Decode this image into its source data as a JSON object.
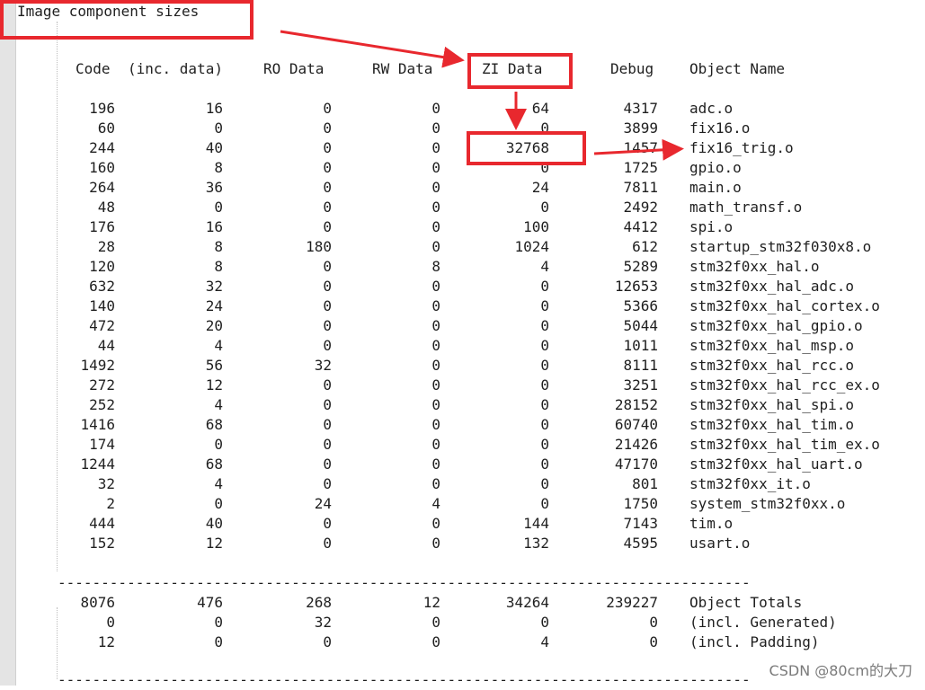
{
  "title": "Image component sizes",
  "headers": {
    "code": "Code",
    "inc": "(inc. data)",
    "ro": "RO Data",
    "rw": "RW Data",
    "zi": "ZI Data",
    "debug": "Debug",
    "name": "Object Name"
  },
  "rows": [
    [
      "196",
      "16",
      "0",
      "0",
      "64",
      "4317",
      "adc.o"
    ],
    [
      "60",
      "0",
      "0",
      "0",
      "0",
      "3899",
      "fix16.o"
    ],
    [
      "244",
      "40",
      "0",
      "0",
      "32768",
      "1457",
      "fix16_trig.o"
    ],
    [
      "160",
      "8",
      "0",
      "0",
      "0",
      "1725",
      "gpio.o"
    ],
    [
      "264",
      "36",
      "0",
      "0",
      "24",
      "7811",
      "main.o"
    ],
    [
      "48",
      "0",
      "0",
      "0",
      "0",
      "2492",
      "math_transf.o"
    ],
    [
      "176",
      "16",
      "0",
      "0",
      "100",
      "4412",
      "spi.o"
    ],
    [
      "28",
      "8",
      "180",
      "0",
      "1024",
      "612",
      "startup_stm32f030x8.o"
    ],
    [
      "120",
      "8",
      "0",
      "8",
      "4",
      "5289",
      "stm32f0xx_hal.o"
    ],
    [
      "632",
      "32",
      "0",
      "0",
      "0",
      "12653",
      "stm32f0xx_hal_adc.o"
    ],
    [
      "140",
      "24",
      "0",
      "0",
      "0",
      "5366",
      "stm32f0xx_hal_cortex.o"
    ],
    [
      "472",
      "20",
      "0",
      "0",
      "0",
      "5044",
      "stm32f0xx_hal_gpio.o"
    ],
    [
      "44",
      "4",
      "0",
      "0",
      "0",
      "1011",
      "stm32f0xx_hal_msp.o"
    ],
    [
      "1492",
      "56",
      "32",
      "0",
      "0",
      "8111",
      "stm32f0xx_hal_rcc.o"
    ],
    [
      "272",
      "12",
      "0",
      "0",
      "0",
      "3251",
      "stm32f0xx_hal_rcc_ex.o"
    ],
    [
      "252",
      "4",
      "0",
      "0",
      "0",
      "28152",
      "stm32f0xx_hal_spi.o"
    ],
    [
      "1416",
      "68",
      "0",
      "0",
      "0",
      "60740",
      "stm32f0xx_hal_tim.o"
    ],
    [
      "174",
      "0",
      "0",
      "0",
      "0",
      "21426",
      "stm32f0xx_hal_tim_ex.o"
    ],
    [
      "1244",
      "68",
      "0",
      "0",
      "0",
      "47170",
      "stm32f0xx_hal_uart.o"
    ],
    [
      "32",
      "4",
      "0",
      "0",
      "0",
      "801",
      "stm32f0xx_it.o"
    ],
    [
      "2",
      "0",
      "24",
      "4",
      "0",
      "1750",
      "system_stm32f0xx.o"
    ],
    [
      "444",
      "40",
      "0",
      "0",
      "144",
      "7143",
      "tim.o"
    ],
    [
      "152",
      "12",
      "0",
      "0",
      "132",
      "4595",
      "usart.o"
    ]
  ],
  "separator": "----------------------------------------------------------------------------------------------------------------",
  "totals": [
    [
      "8076",
      "476",
      "268",
      "12",
      "34264",
      "239227",
      "Object Totals"
    ],
    [
      "0",
      "0",
      "32",
      "0",
      "0",
      "0",
      "(incl. Generated)"
    ],
    [
      "12",
      "0",
      "0",
      "0",
      "4",
      "0",
      "(incl. Padding)"
    ]
  ],
  "watermark": "CSDN @80cm的大刀",
  "annotation_color": "#e8282e"
}
